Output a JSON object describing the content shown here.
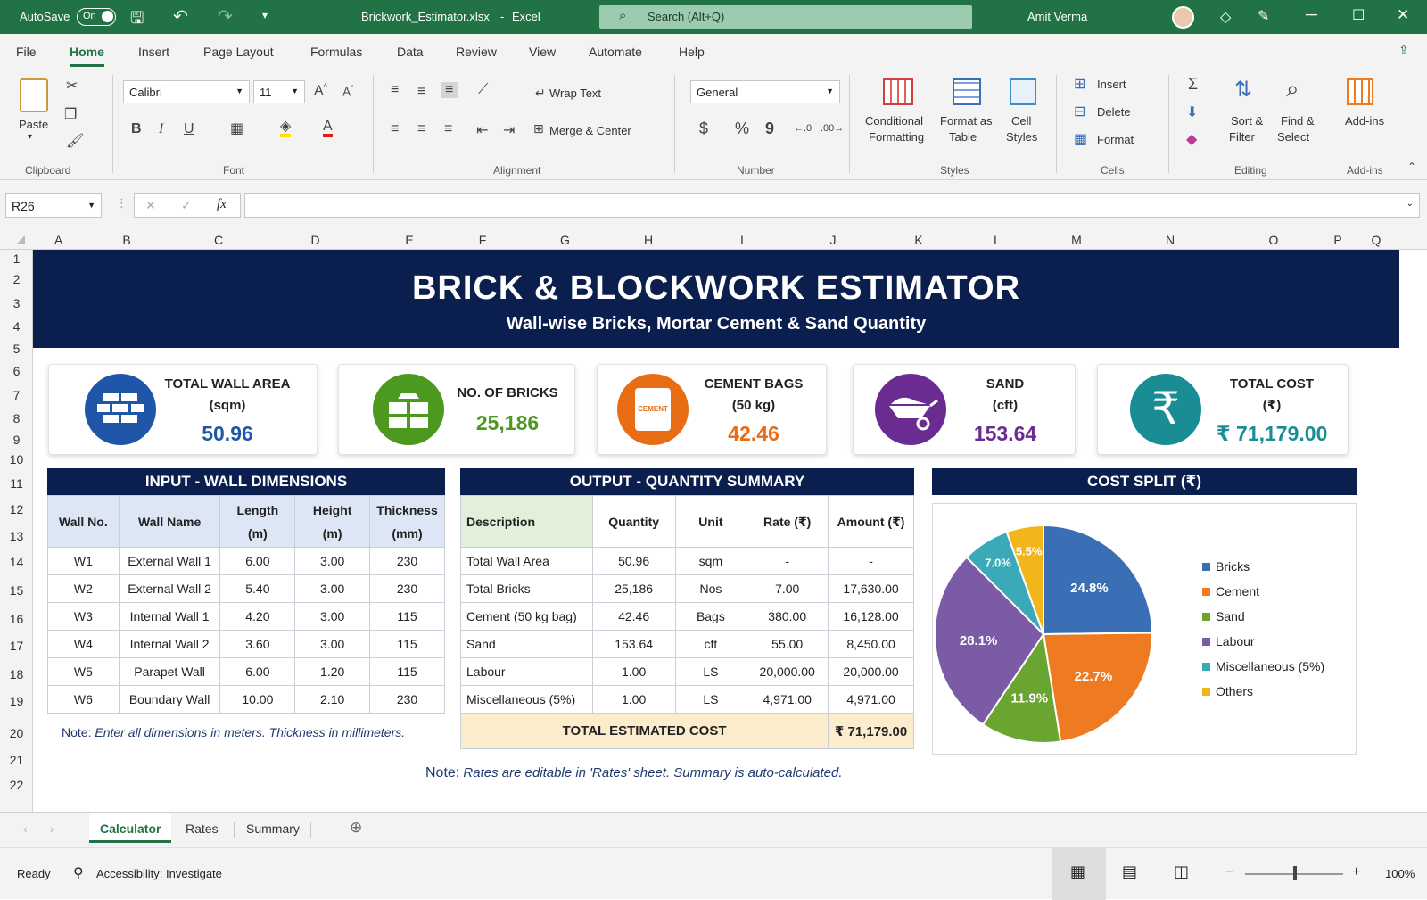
{
  "title_bar": {
    "autosave_label": "AutoSave",
    "autosave_state": "On",
    "file_name": "Brickwork_Estimator.xlsx",
    "separator": "-",
    "app_name": "Excel",
    "search_placeholder": "Search (Alt+Q)",
    "user_name": "Amit Verma"
  },
  "ribbon_tabs": [
    "File",
    "Home",
    "Insert",
    "Page Layout",
    "Formulas",
    "Data",
    "Review",
    "View",
    "Automate",
    "Help"
  ],
  "ribbon": {
    "clipboard": {
      "paste": "Paste",
      "group": "Clipboard"
    },
    "font": {
      "name": "Calibri",
      "size": "11",
      "group": "Font",
      "bold": "B",
      "italic": "I",
      "underline": "U"
    },
    "alignment": {
      "wrap_text": "Wrap Text",
      "merge_center": "Merge & Center",
      "group": "Alignment"
    },
    "number": {
      "format": "General",
      "group": "Number",
      "currency": "$",
      "percent": "%",
      "comma": "9"
    },
    "styles": {
      "conditional": "Conditional",
      "conditional2": "Formatting",
      "format_as": "Format as",
      "format_as2": "Table",
      "cell": "Cell",
      "cell2": "Styles",
      "group": "Styles"
    },
    "cells": {
      "insert": "Insert",
      "delete": "Delete",
      "format": "Format",
      "group": "Cells"
    },
    "editing": {
      "sort": "Sort &",
      "sort2": "Filter",
      "find": "Find &",
      "find2": "Select",
      "group": "Editing"
    },
    "addins": {
      "label": "Add-ins",
      "group": "Add-ins"
    }
  },
  "formula_bar": {
    "name_box": "R26",
    "fx": "fx",
    "cancel": "✕",
    "enter": "✓",
    "value": ""
  },
  "columns": [
    "A",
    "B",
    "C",
    "D",
    "E",
    "F",
    "G",
    "H",
    "I",
    "J",
    "K",
    "L",
    "M",
    "N",
    "O",
    "P",
    "Q"
  ],
  "rows": [
    "1",
    "2",
    "3",
    "4",
    "5",
    "6",
    "7",
    "8",
    "9",
    "10",
    "11",
    "12",
    "13",
    "14",
    "15",
    "16",
    "17",
    "18",
    "19",
    "20",
    "21",
    "22"
  ],
  "banner": {
    "title": "BRICK & BLOCKWORK ESTIMATOR",
    "subtitle": "Wall-wise Bricks, Mortar Cement & Sand Quantity"
  },
  "kpis": [
    {
      "label1": "TOTAL WALL AREA",
      "label2": "(sqm)",
      "value": "50.96",
      "color": "#1f56a8"
    },
    {
      "label1": "NO. OF BRICKS",
      "label2": "",
      "value": "25,186",
      "color": "#4b9a1f"
    },
    {
      "label1": "CEMENT BAGS",
      "label2": "(50 kg)",
      "value": "42.46",
      "color": "#e86c14",
      "bag_text": "CEMENT"
    },
    {
      "label1": "SAND",
      "label2": "(cft)",
      "value": "153.64",
      "color": "#6a2c91"
    },
    {
      "label1": "TOTAL COST",
      "label2": "(₹)",
      "value": "₹ 71,179.00",
      "color": "#1a8c93",
      "icon": "₹"
    }
  ],
  "input_table": {
    "title": "INPUT - WALL DIMENSIONS",
    "headers": [
      [
        "Wall No.",
        ""
      ],
      [
        "Wall Name",
        ""
      ],
      [
        "Length",
        "(m)"
      ],
      [
        "Height",
        "(m)"
      ],
      [
        "Thickness",
        "(mm)"
      ]
    ],
    "rows": [
      [
        "W1",
        "External Wall 1",
        "6.00",
        "3.00",
        "230"
      ],
      [
        "W2",
        "External Wall 2",
        "5.40",
        "3.00",
        "230"
      ],
      [
        "W3",
        "Internal Wall 1",
        "4.20",
        "3.00",
        "115"
      ],
      [
        "W4",
        "Internal Wall 2",
        "3.60",
        "3.00",
        "115"
      ],
      [
        "W5",
        "Parapet Wall",
        "6.00",
        "1.20",
        "115"
      ],
      [
        "W6",
        "Boundary Wall",
        "10.00",
        "2.10",
        "230"
      ]
    ],
    "note_prefix": "Note:",
    "note": " Enter all dimensions in meters. Thickness in millimeters."
  },
  "output_table": {
    "title": "OUTPUT - QUANTITY SUMMARY",
    "headers": [
      "Description",
      "Quantity",
      "Unit",
      "Rate (₹)",
      "Amount (₹)"
    ],
    "rows": [
      [
        "Total Wall Area",
        "50.96",
        "sqm",
        "-",
        "-"
      ],
      [
        "Total Bricks",
        "25,186",
        "Nos",
        "7.00",
        "17,630.00"
      ],
      [
        "Cement (50 kg bag)",
        "42.46",
        "Bags",
        "380.00",
        "16,128.00"
      ],
      [
        "Sand",
        "153.64",
        "cft",
        "55.00",
        "8,450.00"
      ],
      [
        "Labour",
        "1.00",
        "LS",
        "20,000.00",
        "20,000.00"
      ],
      [
        "Miscellaneous (5%)",
        "1.00",
        "LS",
        "4,971.00",
        "4,971.00"
      ]
    ],
    "total_label": "TOTAL ESTIMATED COST",
    "total_value": "₹ 71,179.00"
  },
  "bottom_note": {
    "prefix": "Note:",
    "text": " Rates are editable in 'Rates' sheet. Summary is auto-calculated."
  },
  "chart_data": {
    "type": "pie",
    "title": "COST SPLIT (₹)",
    "categories": [
      "Bricks",
      "Cement",
      "Sand",
      "Labour",
      "Miscellaneous (5%)",
      "Others"
    ],
    "values": [
      24.8,
      22.7,
      11.9,
      28.1,
      7.0,
      5.5
    ],
    "labels": [
      "24.8%",
      "22.7%",
      "11.9%",
      "28.1%",
      "7.0%",
      "5.5%"
    ],
    "colors": [
      "#3a6fb5",
      "#ee7a22",
      "#6aa532",
      "#7c5ba6",
      "#3aaab8",
      "#f2b51c"
    ],
    "legend": "right"
  },
  "sheet_tabs": [
    "Calculator",
    "Rates",
    "Summary"
  ],
  "status_bar": {
    "ready": "Ready",
    "accessibility": "Accessibility: Investigate",
    "zoom": "100%",
    "minus": "−",
    "plus": "+"
  }
}
